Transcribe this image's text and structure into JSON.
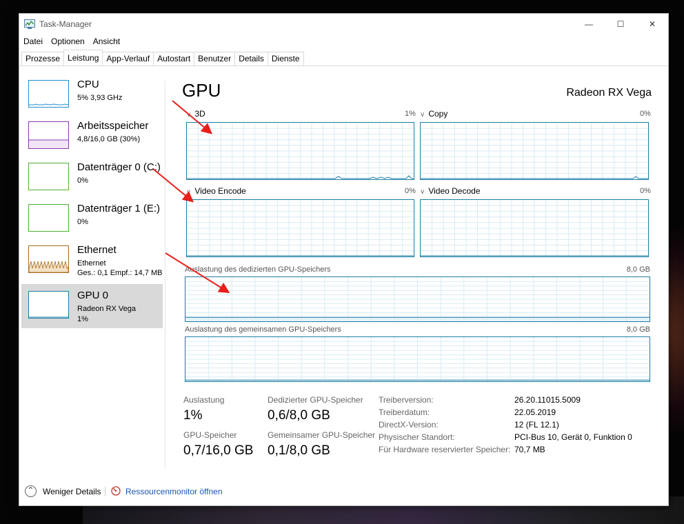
{
  "window": {
    "title": "Task-Manager",
    "controls": {
      "minimize": "—",
      "maximize": "☐",
      "close": "✕"
    }
  },
  "menu": [
    "Datei",
    "Optionen",
    "Ansicht"
  ],
  "tabs": [
    {
      "label": "Prozesse",
      "active": false
    },
    {
      "label": "Leistung",
      "active": true
    },
    {
      "label": "App-Verlauf",
      "active": false
    },
    {
      "label": "Autostart",
      "active": false
    },
    {
      "label": "Benutzer",
      "active": false
    },
    {
      "label": "Details",
      "active": false
    },
    {
      "label": "Dienste",
      "active": false
    }
  ],
  "sidebar": {
    "items": [
      {
        "title": "CPU",
        "sub1": "5%  3,93 GHz",
        "sub2": "",
        "sub3": "",
        "color": "#1f8fcf",
        "selected": false
      },
      {
        "title": "Arbeitsspeicher",
        "sub1": "4,8/16,0 GB (30%)",
        "sub2": "",
        "sub3": "",
        "color": "#8b3aa8",
        "selected": false
      },
      {
        "title": "Datenträger 0 (C:)",
        "sub1": "0%",
        "sub2": "",
        "sub3": "",
        "color": "#4caf34",
        "selected": false
      },
      {
        "title": "Datenträger 1 (E:)",
        "sub1": "0%",
        "sub2": "",
        "sub3": "",
        "color": "#4caf34",
        "selected": false
      },
      {
        "title": "Ethernet",
        "sub1": "Ethernet",
        "sub2": "Ges.: 0,1  Empf.: 14,7 MB",
        "sub3": "",
        "color": "#a76b1c",
        "selected": false
      },
      {
        "title": "GPU 0",
        "sub1": "Radeon RX Vega",
        "sub2": "1%",
        "sub3": "",
        "color": "#1a7ca6",
        "selected": true
      }
    ]
  },
  "main": {
    "title": "GPU",
    "gpu_name": "Radeon RX Vega",
    "engines": [
      {
        "label": "3D",
        "pct": "1%"
      },
      {
        "label": "Copy",
        "pct": "0%"
      },
      {
        "label": "Video Encode",
        "pct": "0%"
      },
      {
        "label": "Video Decode",
        "pct": "0%"
      }
    ],
    "dedicated": {
      "label": "Auslastung des dedizierten GPU-Speichers",
      "max": "8,0 GB",
      "level": 0.075
    },
    "shared": {
      "label": "Auslastung des gemeinsamen GPU-Speichers",
      "max": "8,0 GB",
      "level": 0.0125
    }
  },
  "stats": {
    "utilization": {
      "label": "Auslastung",
      "value": "1%"
    },
    "dedicated_mem": {
      "label": "Dedizierter GPU-Speicher",
      "value": "0,6/8,0 GB"
    },
    "gpu_mem": {
      "label": "GPU-Speicher",
      "value": "0,7/16,0 GB"
    },
    "shared_mem": {
      "label": "Gemeinsamer GPU-Speicher",
      "value": "0,1/8,0 GB"
    }
  },
  "info": [
    {
      "label": "Treiberversion:",
      "value": "26.20.11015.5009"
    },
    {
      "label": "Treiberdatum:",
      "value": "22.05.2019"
    },
    {
      "label": "DirectX-Version:",
      "value": "12 (FL 12.1)"
    },
    {
      "label": "Physischer Standort:",
      "value": "PCI-Bus 10, Gerät 0, Funktion 0"
    },
    {
      "label": "Für Hardware reservierter Speicher:",
      "value": "70,7 MB"
    }
  ],
  "footer": {
    "less_details": "Weniger Details",
    "resource_monitor": "Ressourcenmonitor öffnen"
  },
  "colors": {
    "gpu_accent": "#1a7ca6",
    "arrow": "#e8201c",
    "link": "#1a56b0"
  }
}
